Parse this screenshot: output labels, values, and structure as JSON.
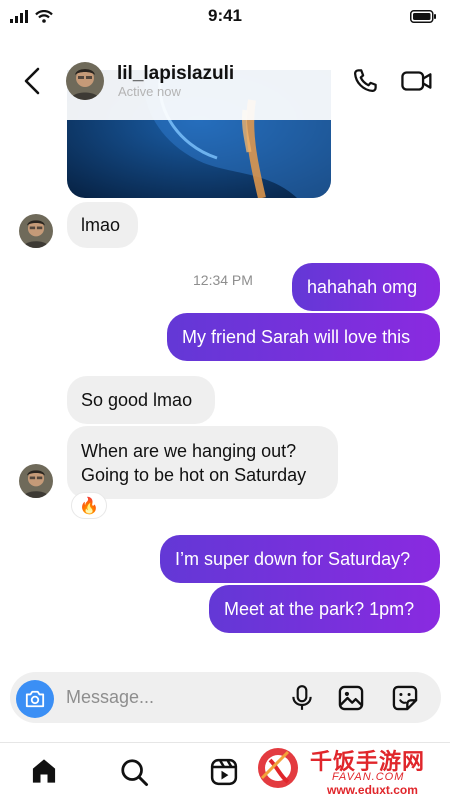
{
  "status_bar": {
    "time": "9:41"
  },
  "header": {
    "username": "lil_lapislazuli",
    "active_status": "Active now"
  },
  "messages": {
    "m1": "lmao",
    "timestamp": "12:34 PM",
    "m2": "hahahah omg",
    "m3": "My friend Sarah will love this",
    "m4": "So good lmao",
    "m5_line1": "When are we hanging out?",
    "m5_line2": "Going to be hot on Saturday",
    "m6": "I’m super down for Saturday?",
    "m7": "Meet at the park? 1pm?"
  },
  "reaction": {
    "emoji": "🔥"
  },
  "composer": {
    "placeholder": "Message..."
  },
  "icons": {
    "back": "chevron-left-icon",
    "phone": "phone-icon",
    "video": "video-camera-icon",
    "camera": "camera-icon",
    "mic": "microphone-icon",
    "gallery": "image-icon",
    "sticker": "sticker-icon",
    "home": "home-icon",
    "search": "search-icon",
    "reels": "reels-icon"
  },
  "watermark": {
    "title": "千饭手游网",
    "subtitle": "FAVAN.COM",
    "url": "www.eduxt.com"
  },
  "colors": {
    "outgoing_start": "#6338d6",
    "outgoing_end": "#8a2ae0",
    "incoming": "#efefef",
    "camera_button": "#3b8ff5",
    "watermark": "#e0262b"
  }
}
